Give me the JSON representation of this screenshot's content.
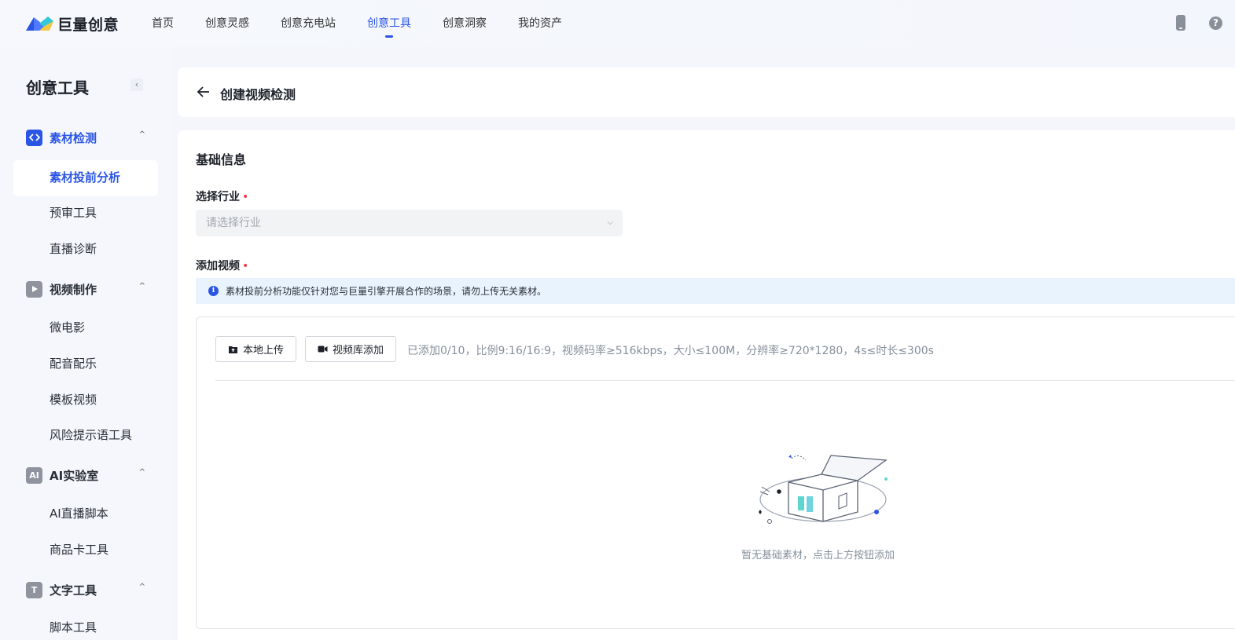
{
  "brand": {
    "name": "巨量创意"
  },
  "nav": {
    "items": [
      {
        "label": "首页"
      },
      {
        "label": "创意灵感"
      },
      {
        "label": "创意充电站"
      },
      {
        "label": "创意工具"
      },
      {
        "label": "创意洞察"
      },
      {
        "label": "我的资产"
      }
    ],
    "active": "创意工具"
  },
  "sidebar": {
    "title": "创意工具",
    "groups": [
      {
        "label": "素材检测",
        "icon": "code-icon",
        "items": [
          "素材投前分析",
          "预审工具",
          "直播诊断"
        ]
      },
      {
        "label": "视频制作",
        "icon": "play-icon",
        "items": [
          "微电影",
          "配音配乐",
          "模板视频",
          "风险提示语工具"
        ]
      },
      {
        "label": "AI实验室",
        "icon": "ai-icon",
        "icon_text": "AI",
        "items": [
          "AI直播脚本",
          "商品卡工具"
        ]
      },
      {
        "label": "文字工具",
        "icon": "text-icon",
        "icon_text": "T",
        "items": [
          "脚本工具"
        ]
      }
    ],
    "active_item": "素材投前分析"
  },
  "page": {
    "title": "创建视频检测",
    "section_title": "基础信息",
    "industry": {
      "label": "选择行业",
      "placeholder": "请选择行业"
    },
    "video": {
      "label": "添加视频"
    },
    "notice": "素材投前分析功能仅针对您与巨量引擎开展合作的场景，请勿上传无关素材。",
    "upload": {
      "local_button": "本地上传",
      "library_button": "视频库添加",
      "hint": "已添加0/10，比例9:16/16:9，视频码率≥516kbps，大小≤100M，分辨率≥720*1280，4s≤时长≤300s",
      "empty_text": "暂无基础素材，点击上方按钮添加"
    }
  },
  "colors": {
    "accent": "#2a55e5",
    "required": "#f2394e",
    "notice_bg": "#e8f3fe"
  }
}
